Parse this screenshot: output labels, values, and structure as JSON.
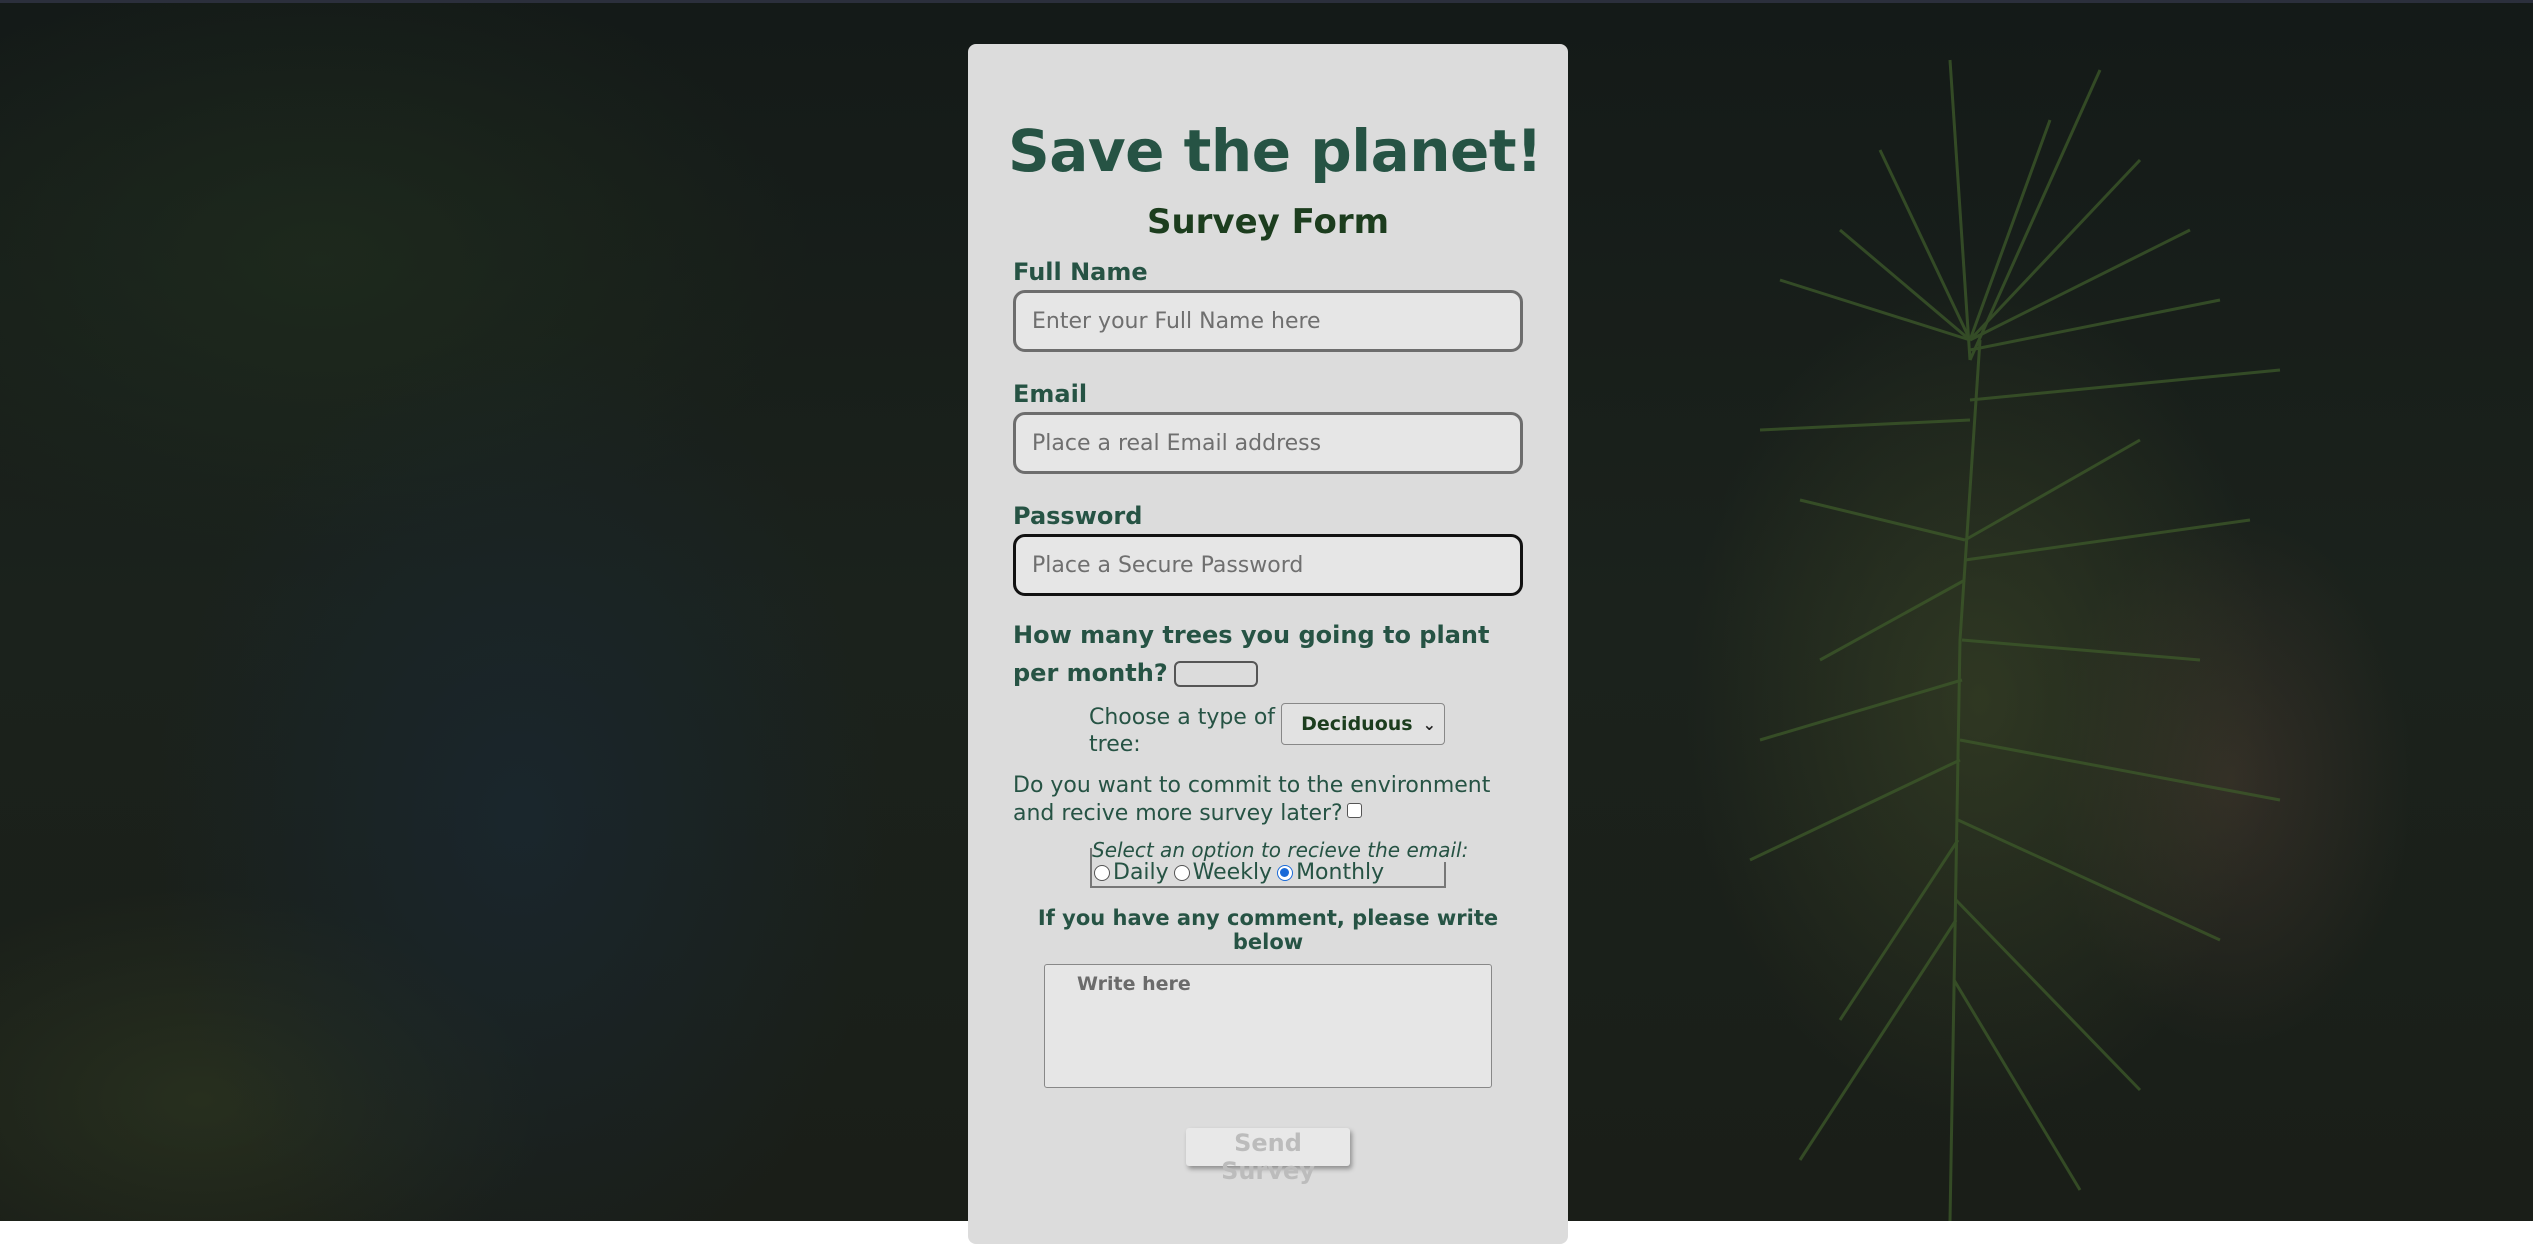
{
  "page": {
    "title": "Save the planet!",
    "subtitle": "Survey Form",
    "icon": "leaf-icon"
  },
  "form": {
    "full_name": {
      "label": "Full Name",
      "placeholder": "Enter your Full Name here"
    },
    "email": {
      "label": "Email",
      "placeholder": "Place a real Email address"
    },
    "password": {
      "label": "Password",
      "placeholder": "Place a Secure Password"
    },
    "trees_question": "How many trees you going to plant per month?",
    "tree_type": {
      "label": "Choose a type of tree:",
      "selected": "Deciduous"
    },
    "commit_question": "Do you want to commit to the environment and recive more survey later?",
    "email_frequency": {
      "legend": "Select an option to recieve the email:",
      "options": [
        "Daily",
        "Weekly",
        "Monthly"
      ],
      "selected": "Monthly"
    },
    "comment": {
      "label": "If you have any comment, please write below",
      "placeholder": "Write here"
    },
    "submit_label": "Send Survey"
  },
  "colors": {
    "accent": "#265344",
    "card_bg": "#dcdcdc",
    "heading_dark": "#1c3d1e"
  }
}
